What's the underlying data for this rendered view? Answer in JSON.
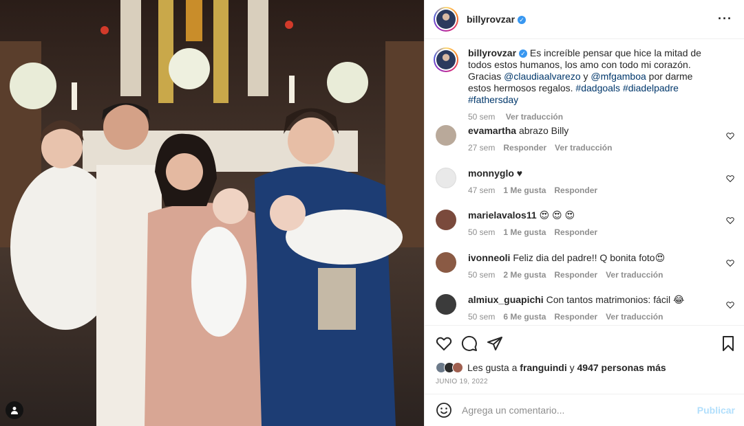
{
  "post_header": {
    "username": "billyrovzar",
    "verified_badge": "✓",
    "more_options_icon": "more-horizontal-icon"
  },
  "caption": {
    "username": "billyrovzar",
    "text_before": "Es increíble pensar que hice la mitad de todos estos humanos, los amo con todo mi corazón. Gracias",
    "mention_1": "@claudiaalvarezo",
    "joiner": "y",
    "mention_2": "@mfgamboa",
    "text_after": "por darme estos hermosos regalos.",
    "hashtags": [
      "#dadgoals",
      "#diadelpadre",
      "#fathersday"
    ],
    "time": "50 sem",
    "translate_label": "Ver traducción"
  },
  "comments": [
    {
      "username": "evamartha",
      "text": "abrazo Billy",
      "time": "27 sem",
      "likes": "",
      "reply_label": "Responder",
      "translate_label": "Ver traducción",
      "avatar_color": "#b9a99a"
    },
    {
      "username": "monnyglo",
      "text": "♥",
      "time": "47 sem",
      "likes": "1 Me gusta",
      "reply_label": "Responder",
      "translate_label": "",
      "avatar_color": "#e9e9e9"
    },
    {
      "username": "marielavalos11",
      "text": "😍 😍 😍",
      "time": "50 sem",
      "likes": "1 Me gusta",
      "reply_label": "Responder",
      "translate_label": "",
      "avatar_color": "#7a4a3c"
    },
    {
      "username": "ivonneoli",
      "text": "Feliz dia del padre!! Q bonita foto😍",
      "time": "50 sem",
      "likes": "2 Me gusta",
      "reply_label": "Responder",
      "translate_label": "Ver traducción",
      "avatar_color": "#8a5a44"
    },
    {
      "username": "almiux_guapichi",
      "text": "Con tantos matrimonios: fácil 😂",
      "time": "50 sem",
      "likes": "6 Me gusta",
      "reply_label": "Responder",
      "translate_label": "Ver traducción",
      "avatar_color": "#3b3b3b"
    }
  ],
  "likes": {
    "prefix": "Les gusta a",
    "user": "franguindi",
    "joiner": "y",
    "others": "4947 personas más"
  },
  "date": "JUNIO 19, 2022",
  "add_comment": {
    "placeholder": "Agrega un comentario...",
    "publish_label": "Publicar"
  },
  "colors": {
    "link": "#00376b",
    "muted": "#8e8e8e",
    "verified": "#3897f0",
    "publish_disabled": "#b2dffc"
  }
}
